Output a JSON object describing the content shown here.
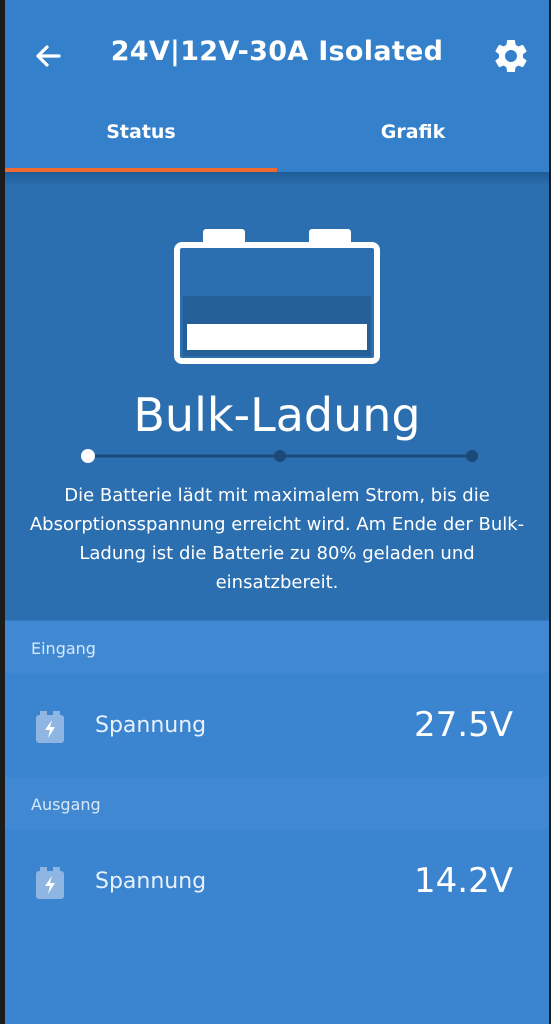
{
  "header": {
    "title": "24V|12V-30A Isolated",
    "back_icon": "arrow-left-icon",
    "settings_icon": "gear-icon"
  },
  "tabs": [
    {
      "label": "Status",
      "active": true
    },
    {
      "label": "Grafik",
      "active": false
    }
  ],
  "status": {
    "state_title": "Bulk-Ladung",
    "description": "Die Batterie lädt mit maximalem Strom, bis die Absorptionsspannung erreicht wird. Am Ende der Bulk-Ladung ist die Batterie zu 80% geladen und einsatzbereit.",
    "stage_count": 3,
    "current_stage": 1,
    "battery_icon": "battery-icon"
  },
  "input": {
    "section_label": "Eingang",
    "rows": [
      {
        "icon": "battery-bolt-icon",
        "label": "Spannung",
        "value": "27.5V"
      }
    ]
  },
  "output": {
    "section_label": "Ausgang",
    "rows": [
      {
        "icon": "battery-bolt-icon",
        "label": "Spannung",
        "value": "14.2V"
      }
    ]
  },
  "colors": {
    "accent_tab_indicator": "#ef6a2f",
    "app_bar": "#3580cb",
    "hero_bg": "#2b6fb0",
    "row_bg": "#3b84cf"
  }
}
